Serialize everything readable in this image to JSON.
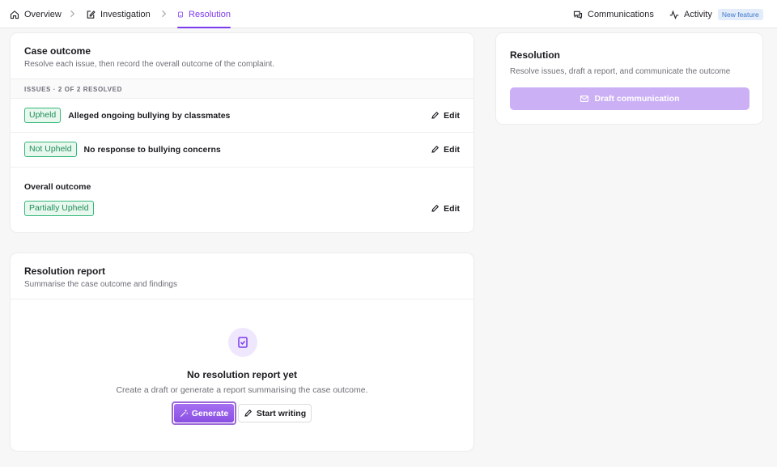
{
  "nav": {
    "overview": "Overview",
    "investigation": "Investigation",
    "resolution": "Resolution",
    "communications": "Communications",
    "activity": "Activity",
    "new_feature": "New feature",
    "accent_color": "#7c3aed"
  },
  "case_outcome": {
    "title": "Case outcome",
    "subtitle": "Resolve each issue, then record the overall outcome of the complaint.",
    "issues_header": "ISSUES · 2 OF 2 RESOLVED",
    "issues": [
      {
        "status": "Upheld",
        "text": "Alleged ongoing bullying by classmates",
        "edit": "Edit"
      },
      {
        "status": "Not Upheld",
        "text": "No response to bullying concerns",
        "edit": "Edit"
      }
    ],
    "overall_label": "Overall outcome",
    "overall_status": "Partially Upheld",
    "overall_edit": "Edit"
  },
  "resolution_report": {
    "title": "Resolution report",
    "subtitle": "Summarise the case outcome and findings",
    "empty_title": "No resolution report yet",
    "empty_subtitle": "Create a draft or generate a report summarising the case outcome.",
    "generate_label": "Generate",
    "start_writing_label": "Start writing"
  },
  "side_panel": {
    "title": "Resolution",
    "subtitle": "Resolve issues, draft a report, and communicate the outcome",
    "draft_label": "Draft communication"
  },
  "icons": {
    "overview": "home-icon",
    "investigation": "edit-square-icon",
    "resolution": "report-icon",
    "communications": "chat-icon",
    "activity": "activity-icon"
  }
}
